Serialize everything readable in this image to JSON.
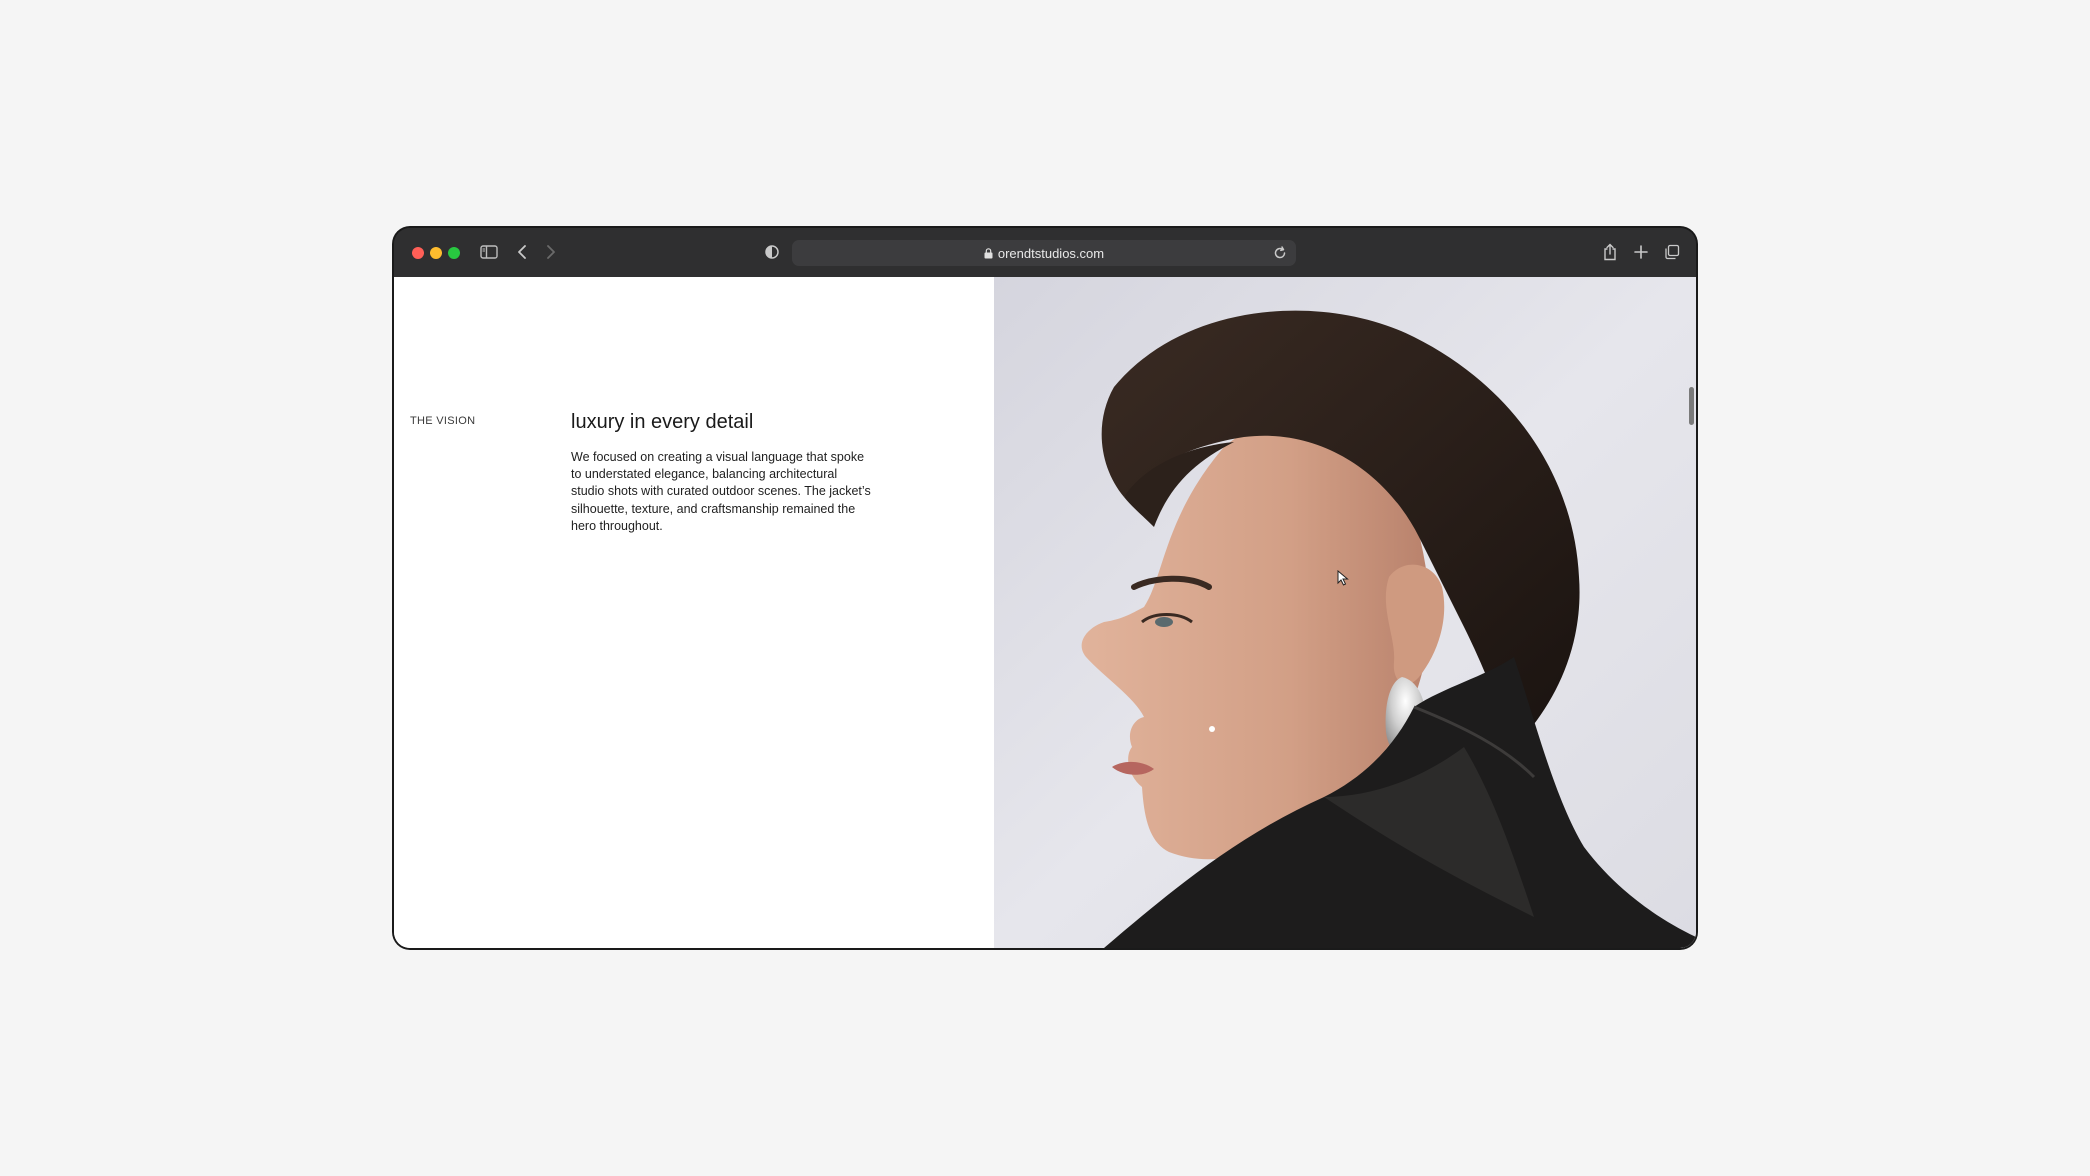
{
  "browser": {
    "url": "orendtstudios.com",
    "icons": [
      "sidebar-icon",
      "back-icon",
      "forward-icon",
      "shield-icon",
      "lock-icon",
      "reload-icon",
      "share-icon",
      "new-tab-icon",
      "tabs-overview-icon"
    ]
  },
  "page": {
    "section_label": "THE VISION",
    "headline": "luxury in every detail",
    "body": "We focused on creating a visual language that spoke to understated elegance, balancing architectural studio shots with curated outdoor scenes. The jacket’s silhouette, texture, and craftsmanship remained the hero throughout."
  },
  "image": {
    "subject": "portrait-photo",
    "colors": {
      "background": "#e4e4ea",
      "hair": "#2a1f1a",
      "skin": "#d9a88e",
      "jacket": "#1c1b1b",
      "earring": "#d8d8d8"
    }
  }
}
